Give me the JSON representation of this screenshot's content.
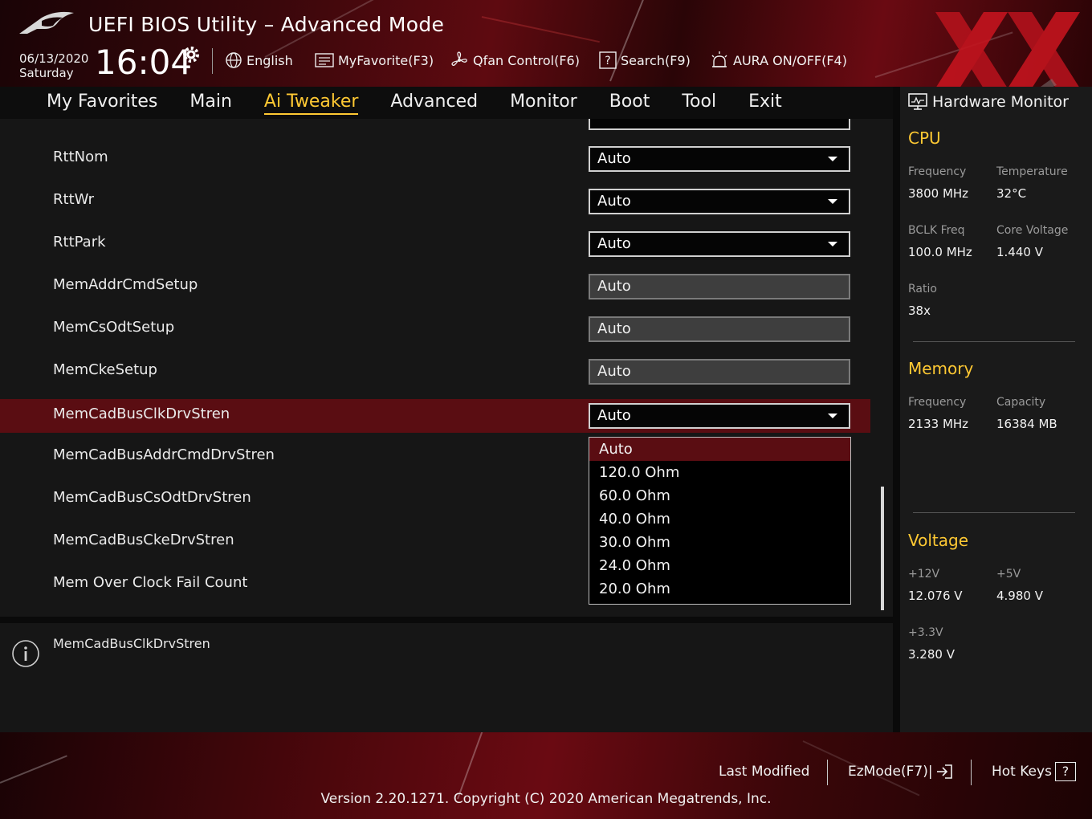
{
  "app": {
    "title": "UEFI BIOS Utility – Advanced Mode"
  },
  "header": {
    "date": "06/13/2020",
    "day": "Saturday",
    "time": "16:04",
    "language": "English",
    "my_favorite": "MyFavorite(F3)",
    "qfan": "Qfan Control(F6)",
    "search": "Search(F9)",
    "aura": "AURA ON/OFF(F4)"
  },
  "nav": {
    "tabs": [
      {
        "label": "My Favorites"
      },
      {
        "label": "Main"
      },
      {
        "label": "Ai Tweaker"
      },
      {
        "label": "Advanced"
      },
      {
        "label": "Monitor"
      },
      {
        "label": "Boot"
      },
      {
        "label": "Tool"
      },
      {
        "label": "Exit"
      }
    ],
    "active": "Ai Tweaker"
  },
  "settings": [
    {
      "label": "RttNom",
      "value": "Auto",
      "type": "dropdown"
    },
    {
      "label": "RttWr",
      "value": "Auto",
      "type": "dropdown"
    },
    {
      "label": "RttPark",
      "value": "Auto",
      "type": "dropdown"
    },
    {
      "label": "MemAddrCmdSetup",
      "value": "Auto",
      "type": "fixed"
    },
    {
      "label": "MemCsOdtSetup",
      "value": "Auto",
      "type": "fixed"
    },
    {
      "label": "MemCkeSetup",
      "value": "Auto",
      "type": "fixed"
    },
    {
      "label": "MemCadBusClkDrvStren",
      "value": "Auto",
      "type": "dropdown",
      "selected": true
    },
    {
      "label": "MemCadBusAddrCmdDrvStren"
    },
    {
      "label": "MemCadBusCsOdtDrvStren"
    },
    {
      "label": "MemCadBusCkeDrvStren"
    },
    {
      "label": "Mem Over Clock Fail Count"
    }
  ],
  "dropdown_options": [
    "Auto",
    "120.0 Ohm",
    "60.0 Ohm",
    "40.0 Ohm",
    "30.0 Ohm",
    "24.0 Ohm",
    "20.0 Ohm"
  ],
  "dropdown_selected": "Auto",
  "help": {
    "text": "MemCadBusClkDrvStren"
  },
  "hw_monitor": {
    "title": "Hardware Monitor",
    "cpu": {
      "title": "CPU",
      "frequency_label": "Frequency",
      "frequency": "3800 MHz",
      "temperature_label": "Temperature",
      "temperature": "32°C",
      "bclk_label": "BCLK Freq",
      "bclk": "100.0 MHz",
      "core_voltage_label": "Core Voltage",
      "core_voltage": "1.440 V",
      "ratio_label": "Ratio",
      "ratio": "38x"
    },
    "memory": {
      "title": "Memory",
      "frequency_label": "Frequency",
      "frequency": "2133 MHz",
      "capacity_label": "Capacity",
      "capacity": "16384 MB"
    },
    "voltage": {
      "title": "Voltage",
      "v12_label": "+12V",
      "v12": "12.076 V",
      "v5_label": "+5V",
      "v5": "4.980 V",
      "v33_label": "+3.3V",
      "v33": "3.280 V"
    }
  },
  "footer": {
    "last_modified": "Last Modified",
    "ezmode": "EzMode(F7)|",
    "hotkeys": "Hot Keys",
    "hotkeys_key": "?",
    "copyright": "Version 2.20.1271. Copyright (C) 2020 American Megatrends, Inc."
  },
  "colors": {
    "accent": "#ffc933",
    "highlight": "#5a0d12",
    "brand_red": "#6a0a12"
  },
  "icons": [
    "rog-logo-icon",
    "gear-icon",
    "globe-icon",
    "favorite-list-icon",
    "fan-icon",
    "search-icon",
    "aura-icon",
    "hardware-monitor-icon",
    "info-icon",
    "exit-arrow-icon"
  ]
}
